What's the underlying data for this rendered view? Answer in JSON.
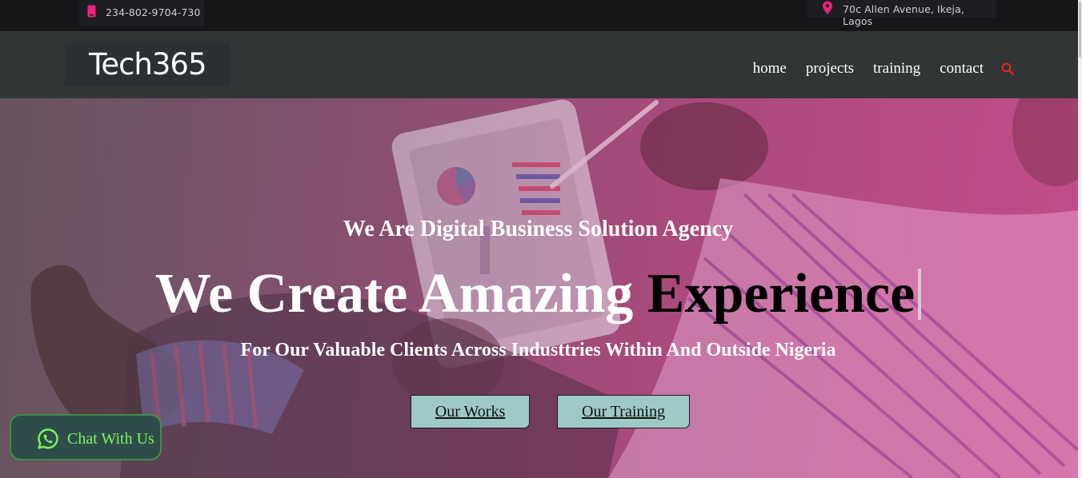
{
  "topbar": {
    "phone": "234-802-9704-730",
    "address": "70c Allen Avenue, Ikeja, Lagos",
    "phone_icon": "phone-icon",
    "address_icon": "map-pin-icon"
  },
  "brand": {
    "logo_text": "Tech365"
  },
  "nav": {
    "items": [
      {
        "label": "home"
      },
      {
        "label": "projects"
      },
      {
        "label": "training"
      },
      {
        "label": "contact"
      }
    ],
    "search_icon": "search-icon"
  },
  "hero": {
    "subtitle": "We Are Digital Business Solution Agency",
    "headline_light": "We Create Amazing ",
    "headline_dark": "Experience",
    "tagline": "For Our Valuable Clients Across Industtries Within And Outside Nigeria",
    "buttons": {
      "works": "Our Works",
      "training": "Our Training"
    }
  },
  "chat_widget": {
    "label": "Chat With Us",
    "icon": "whatsapp-icon"
  },
  "colors": {
    "accent": "#e8237a",
    "topbar_bg": "#161618",
    "navbar_bg": "#323536",
    "button_bg": "#9ec9c6",
    "chat_text": "#7ef25c",
    "search_icon": "#e02424"
  }
}
